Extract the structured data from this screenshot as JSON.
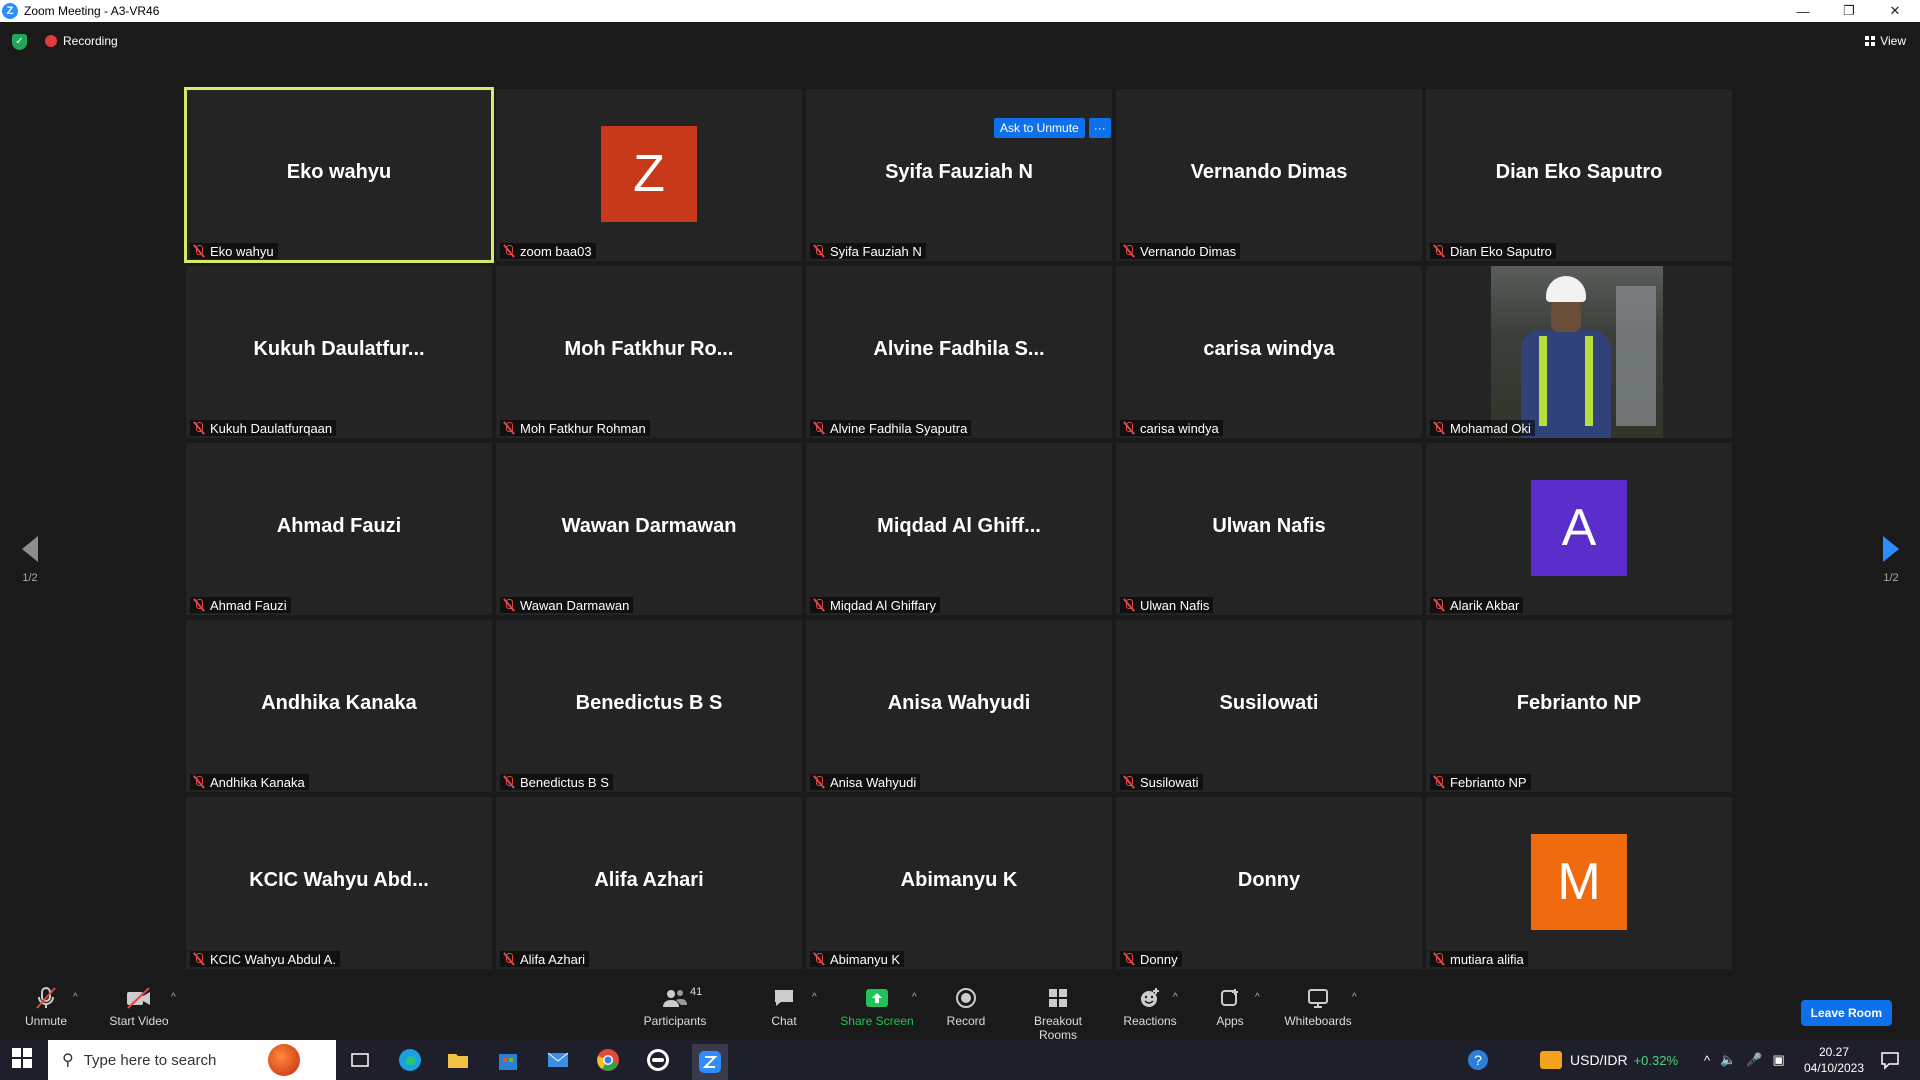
{
  "window": {
    "title": "Zoom Meeting - A3-VR46"
  },
  "top": {
    "recording": "Recording",
    "view": "View"
  },
  "tiles": [
    {
      "name": "Eko wahyu",
      "label": "Eko wahyu",
      "active": true
    },
    {
      "avatar": "Z",
      "avatar_color": "#c8391b",
      "label": "zoom baa03"
    },
    {
      "name": "Syifa Fauziah N",
      "label": "Syifa Fauziah N"
    },
    {
      "name": "Vernando Dimas",
      "label": "Vernando Dimas"
    },
    {
      "name": "Dian Eko Saputro",
      "label": "Dian Eko Saputro"
    },
    {
      "name": "Kukuh  Daulatfur...",
      "label": "Kukuh Daulatfurqaan"
    },
    {
      "name": "Moh  Fatkhur  Ro...",
      "label": "Moh Fatkhur Rohman"
    },
    {
      "name": "Alvine  Fadhila  S...",
      "label": "Alvine Fadhila Syaputra"
    },
    {
      "name": "carisa windya",
      "label": "carisa windya"
    },
    {
      "photo": true,
      "label": "Mohamad Oki"
    },
    {
      "name": "Ahmad Fauzi",
      "label": "Ahmad Fauzi"
    },
    {
      "name": "Wawan Darmawan",
      "label": "Wawan Darmawan"
    },
    {
      "name": "Miqdad  Al  Ghiff...",
      "label": "Miqdad Al Ghiffary"
    },
    {
      "name": "Ulwan Nafis",
      "label": "Ulwan Nafis"
    },
    {
      "avatar": "A",
      "avatar_color": "#5b2ecb",
      "label": "Alarik Akbar"
    },
    {
      "name": "Andhika Kanaka",
      "label": "Andhika Kanaka"
    },
    {
      "name": "Benedictus B S",
      "label": "Benedictus B S"
    },
    {
      "name": "Anisa Wahyudi",
      "label": "Anisa Wahyudi"
    },
    {
      "name": "Susilowati",
      "label": "Susilowati"
    },
    {
      "name": "Febrianto NP",
      "label": "Febrianto NP"
    },
    {
      "name": "KCIC  Wahyu  Abd...",
      "label": "KCIC Wahyu Abdul A."
    },
    {
      "name": "Alifa Azhari",
      "label": "Alifa Azhari"
    },
    {
      "name": "Abimanyu K",
      "label": "Abimanyu K"
    },
    {
      "name": "Donny",
      "label": "Donny"
    },
    {
      "avatar": "M",
      "avatar_color": "#f06a0f",
      "label": "mutiara alifia"
    }
  ],
  "hover": {
    "ask_to_unmute": "Ask to Unmute",
    "more": "···"
  },
  "pager": {
    "left": "1/2",
    "right": "1/2"
  },
  "toolbar": {
    "unmute": "Unmute",
    "start_video": "Start Video",
    "participants": "Participants",
    "participants_count": "41",
    "chat": "Chat",
    "share_screen": "Share Screen",
    "record": "Record",
    "breakout_rooms": "Breakout Rooms",
    "reactions": "Reactions",
    "apps": "Apps",
    "whiteboards": "Whiteboards",
    "leave": "Leave Room"
  },
  "taskbar": {
    "search_placeholder": "Type here to search",
    "currency": "USD/IDR",
    "currency_change": "+0.32%",
    "time": "20.27",
    "date": "04/10/2023"
  },
  "colors": {
    "accent": "#0e71eb",
    "active_border": "#d7e96a",
    "share_green": "#23c15a",
    "muted_red": "#e04848"
  }
}
